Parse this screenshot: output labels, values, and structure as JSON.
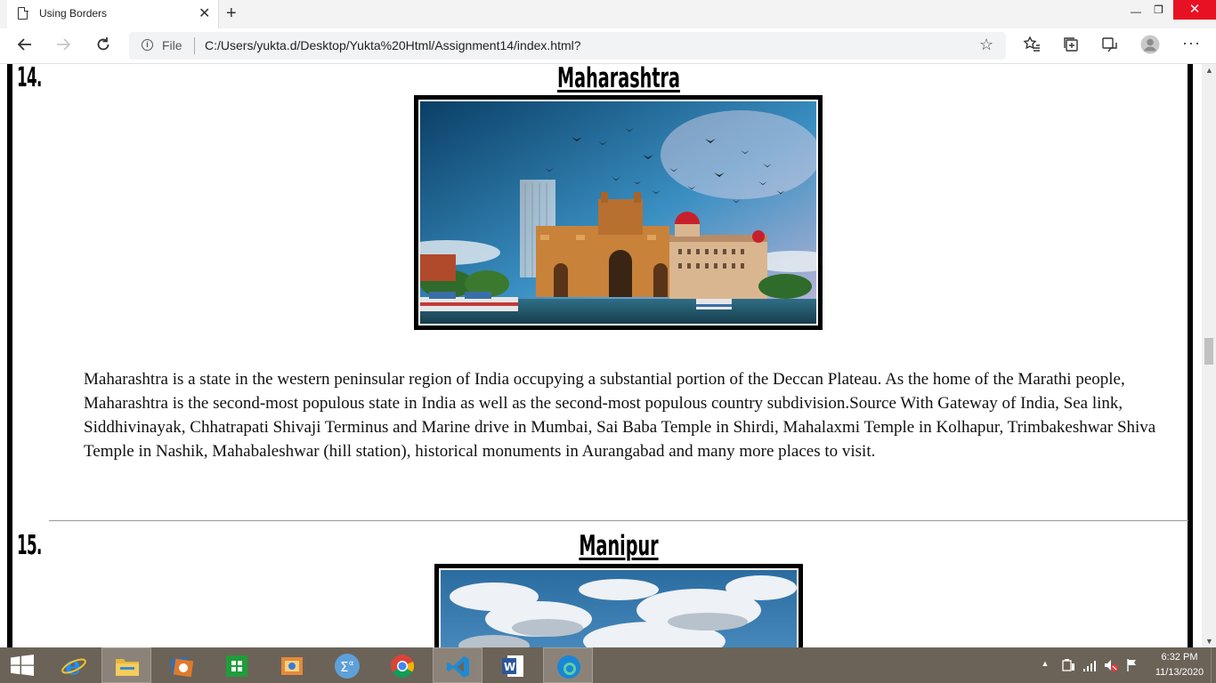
{
  "browser": {
    "tab_title": "Using Borders",
    "tab_close": "✕",
    "new_tab": "+",
    "window_min": "—",
    "window_restore": "❐",
    "window_close": "✕",
    "file_label": "File",
    "url": "C:/Users/yukta.d/Desktop/Yukta%20Html/Assignment14/index.html?",
    "icons": [
      "back-icon",
      "forward-icon",
      "refresh-icon",
      "info-icon",
      "star-icon",
      "favorites-icon",
      "collections-icon",
      "share-icon",
      "profile-icon",
      "more-icon"
    ]
  },
  "page": {
    "sections": [
      {
        "number": "14.",
        "title": "Maharashtra",
        "description": "Maharashtra is a state in the western peninsular region of India occupying a substantial portion of the Deccan Plateau. As the home of the Marathi people, Maharashtra is the second-most populous state in India as well as the second-most populous country subdivision.Source With Gateway of India, Sea link, Siddhivinayak, Chhatrapati Shivaji Terminus and Marine drive in Mumbai, Sai Baba Temple in Shirdi, Mahalaxmi Temple in Kolhapur, Trimbakeshwar Shiva Temple in Nashik, Mahabaleshwar (hill station), historical monuments in Aurangabad and many more places to visit."
      },
      {
        "number": "15.",
        "title": "Manipur"
      }
    ]
  },
  "taskbar": {
    "apps": [
      "start",
      "internet-explorer",
      "file-explorer",
      "media-player",
      "office",
      "math-input",
      "chrome",
      "vscode",
      "word",
      "edge"
    ],
    "time": "6:32 PM",
    "date": "11/13/2020"
  }
}
